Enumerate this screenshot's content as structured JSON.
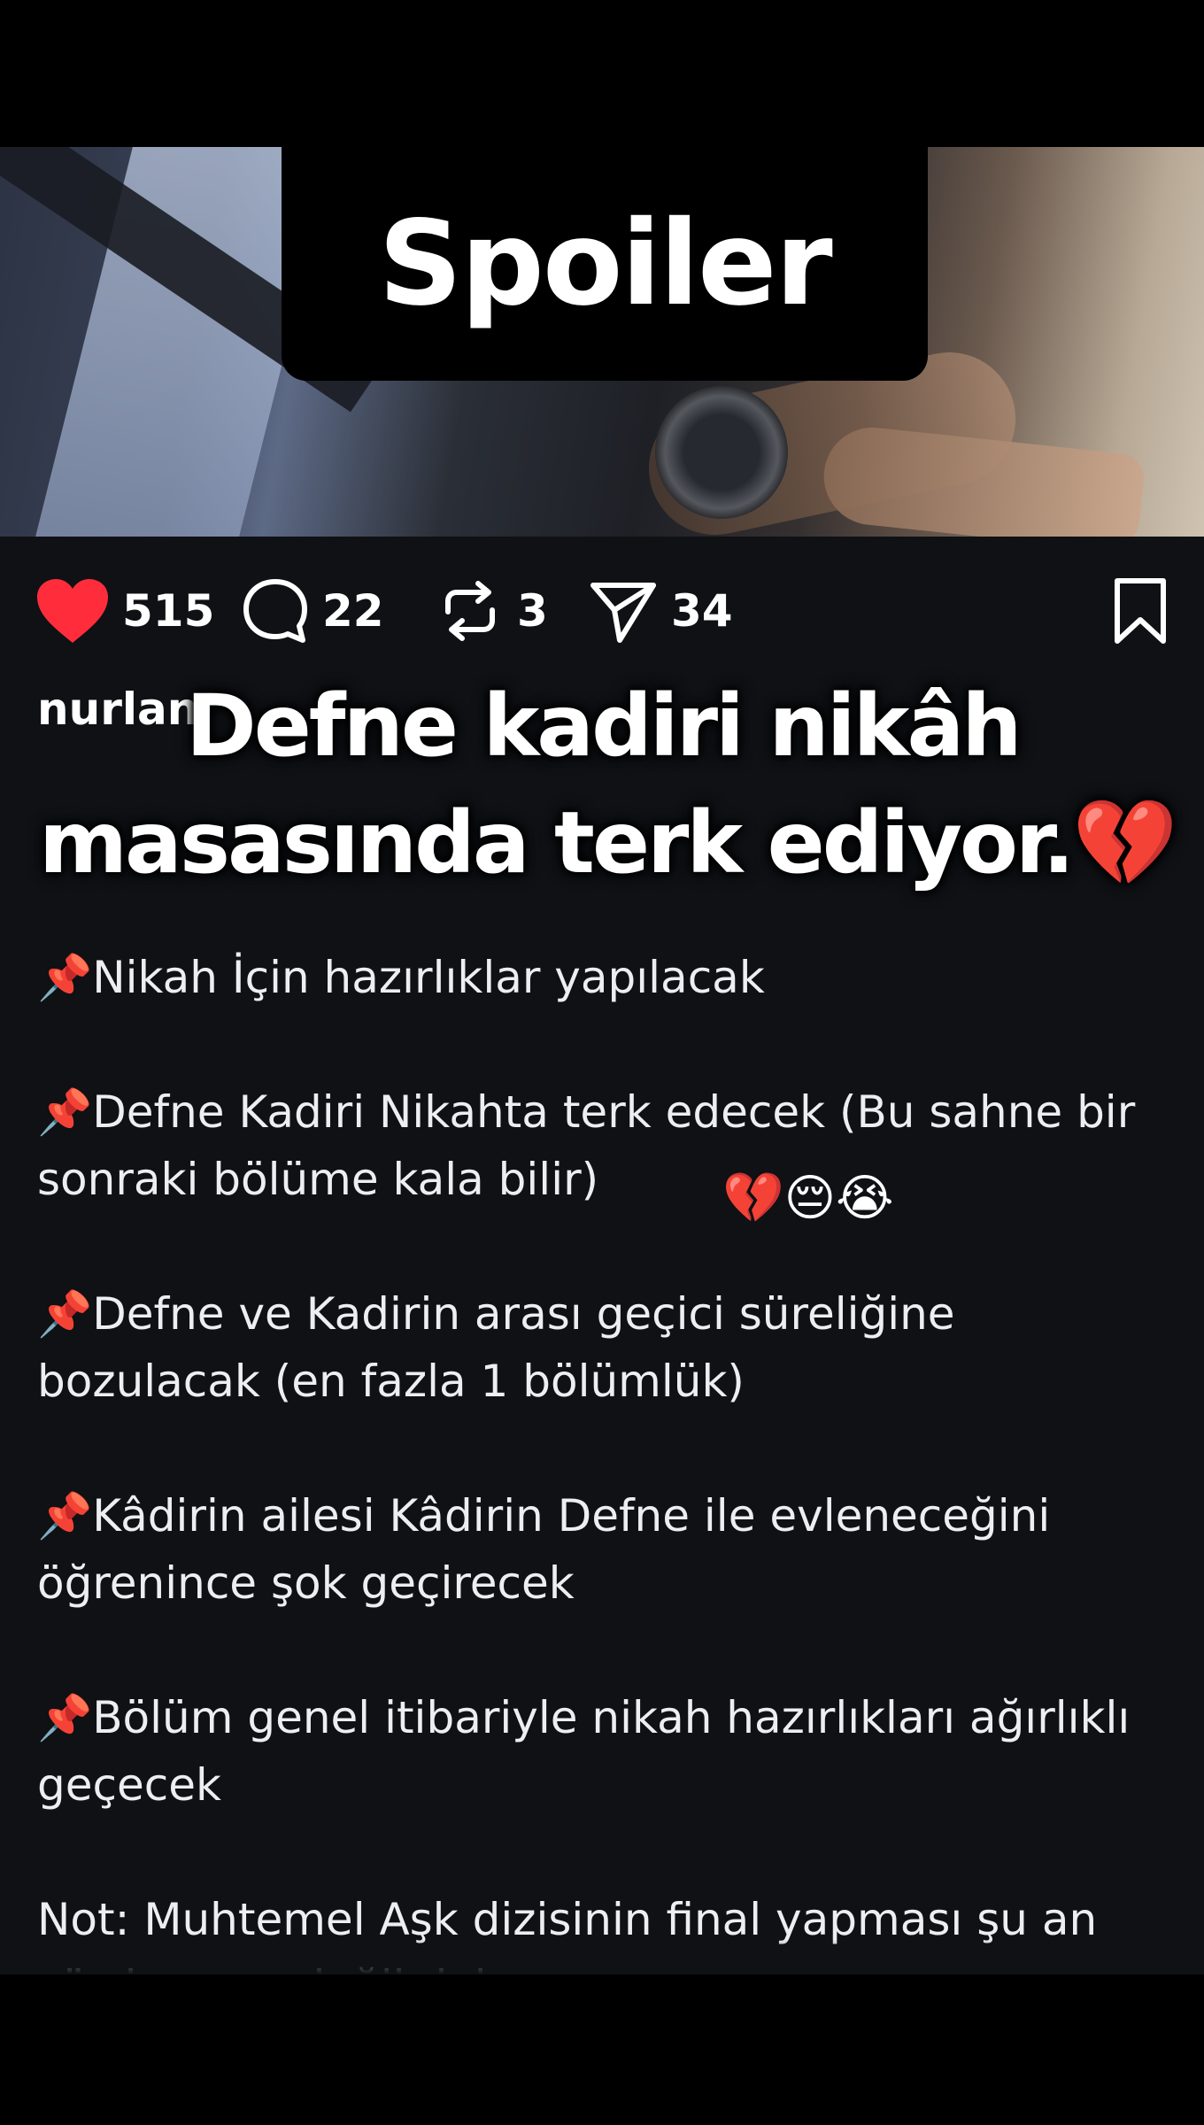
{
  "overlay_title": "Spoiler",
  "actions": {
    "like_count": "515",
    "comment_count": "22",
    "repost_count": "3",
    "share_count": "34",
    "like_color": "#ff2d3c"
  },
  "username_partial": "nurlan",
  "overlay_caption": {
    "line1": "Defne kadiri nikâh",
    "line2": "masasında terk ediyor.💔"
  },
  "post_body": {
    "paragraphs": [
      "📌Nikah İçin hazırlıklar yapılacak",
      "📌Defne Kadiri Nikahta terk edecek (Bu sahne bir sonraki bölüme kala bilir)",
      "📌Defne ve Kadirin arası geçici süreliğine bozulacak (en fazla 1 bölümlük)",
      "📌Kâdirin ailesi Kâdirin Defne ile evleneceğini öğrenince şok geçirecek",
      "📌Bölüm genel itibariyle nikah hazırlıkları ağırlıklı geçecek",
      "Not: Muhtemel Aşk dizisinin final yapması şu an söz konusu değil daha az"
    ],
    "emoji_reaction": "💔😔😭"
  }
}
